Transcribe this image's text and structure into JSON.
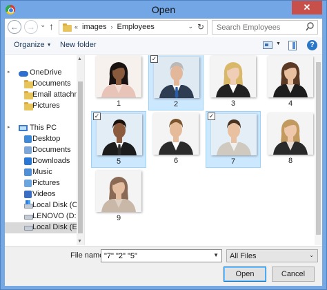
{
  "window": {
    "title": "Open",
    "close_glyph": "✕"
  },
  "nav": {
    "back_glyph": "←",
    "forward_glyph": "→",
    "history_glyph": "⌄",
    "up_glyph": "↑"
  },
  "address": {
    "overflow": "«",
    "crumbs": [
      "images",
      "Employees"
    ],
    "dropdown_glyph": "⌄",
    "refresh_glyph": "↻"
  },
  "search": {
    "placeholder": "Search Employees"
  },
  "toolbar": {
    "organize_label": "Organize",
    "new_folder_label": "New folder",
    "help_glyph": "?"
  },
  "sidebar": {
    "items": [
      {
        "label": "OneDrive",
        "icon": "cloud-icon"
      },
      {
        "label": "Documents",
        "icon": "folder-icon"
      },
      {
        "label": "Email attachments",
        "icon": "folder-icon"
      },
      {
        "label": "Pictures",
        "icon": "folder-icon"
      },
      {
        "label": "This PC",
        "icon": "computer-icon"
      },
      {
        "label": "Desktop",
        "icon": "desktop-icon"
      },
      {
        "label": "Documents",
        "icon": "documents-icon"
      },
      {
        "label": "Downloads",
        "icon": "downloads-icon"
      },
      {
        "label": "Music",
        "icon": "music-icon"
      },
      {
        "label": "Pictures",
        "icon": "pictures-icon"
      },
      {
        "label": "Videos",
        "icon": "videos-icon"
      },
      {
        "label": "Local Disk (C:)",
        "icon": "system-drive-icon"
      },
      {
        "label": "LENOVO (D:)",
        "icon": "drive-icon"
      },
      {
        "label": "Local Disk (E:)",
        "icon": "drive-icon"
      }
    ],
    "expander_glyph": "▸"
  },
  "files": [
    {
      "name": "1",
      "selected": false
    },
    {
      "name": "2",
      "selected": true
    },
    {
      "name": "3",
      "selected": false
    },
    {
      "name": "4",
      "selected": false
    },
    {
      "name": "5",
      "selected": true
    },
    {
      "name": "6",
      "selected": false
    },
    {
      "name": "7",
      "selected": true
    },
    {
      "name": "8",
      "selected": false
    },
    {
      "name": "9",
      "selected": false
    }
  ],
  "check_glyph": "✓",
  "bottom": {
    "filename_label": "File name:",
    "filename_value": "\"7\" \"2\" \"5\"",
    "filetype_value": "All Files",
    "open_label": "Open",
    "cancel_label": "Cancel"
  },
  "colors": {
    "selection_bg": "#cce8ff",
    "selection_border": "#99d1ff",
    "title_bar": "#73a6e4",
    "close_button": "#c7504a"
  }
}
